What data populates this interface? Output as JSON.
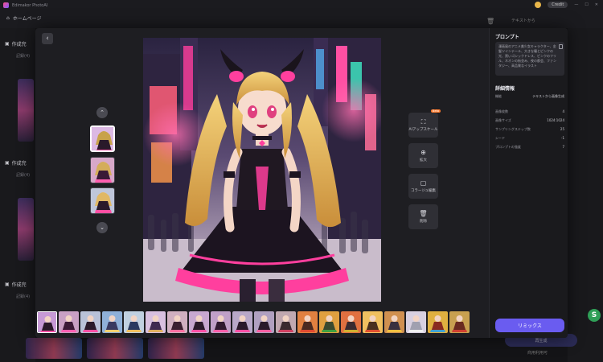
{
  "titlebar": {
    "app_name": "Edimakor PhotoAI",
    "credits": "Credit"
  },
  "bg": {
    "home_label": "ホームページ",
    "section_label": "作成完",
    "sub_label": "記録(4)",
    "regenerate_label": "再生成",
    "remix_note": "商用利用可",
    "top_right_label": "テキストから",
    "help_glyph": "S"
  },
  "modal": {
    "back_glyph": "‹",
    "arrow_up": "⌃",
    "arrow_down": "⌄",
    "tools": [
      {
        "icon": "⛶",
        "label": "AIアップスケール",
        "badge": "Beta"
      },
      {
        "icon": "⊕",
        "label": "拡大"
      },
      {
        "icon": "▢",
        "label": "コラージュ編集"
      },
      {
        "icon": "🗑",
        "label": "削除"
      }
    ]
  },
  "panel": {
    "prompt_title": "プロンプト",
    "prompt_text": "漫画風のアニメ美少女キャラクター、金髪ツインテール、大きな瞳とピンクの光、黒いゴシックドレス、ピンクのフリル、ネオンの街並み、夜の都会、ファンタジー、高品質なイラスト",
    "details_title": "詳細情報",
    "details": [
      {
        "k": "機能",
        "v": "テキストから画像生成"
      },
      {
        "k": "画像枚数",
        "v": "4"
      },
      {
        "k": "画像サイズ",
        "v": "1024:1024"
      },
      {
        "k": "サンプリングステップ数",
        "v": "25"
      },
      {
        "k": "シード",
        "v": "-1"
      },
      {
        "k": "プロンプトの強度",
        "v": "7"
      }
    ],
    "remix_label": "リミックス"
  },
  "colors": {
    "accent": "#6a5cf0",
    "neon_pink": "#ff3f9e",
    "panel_bg": "#1a1a1d"
  }
}
